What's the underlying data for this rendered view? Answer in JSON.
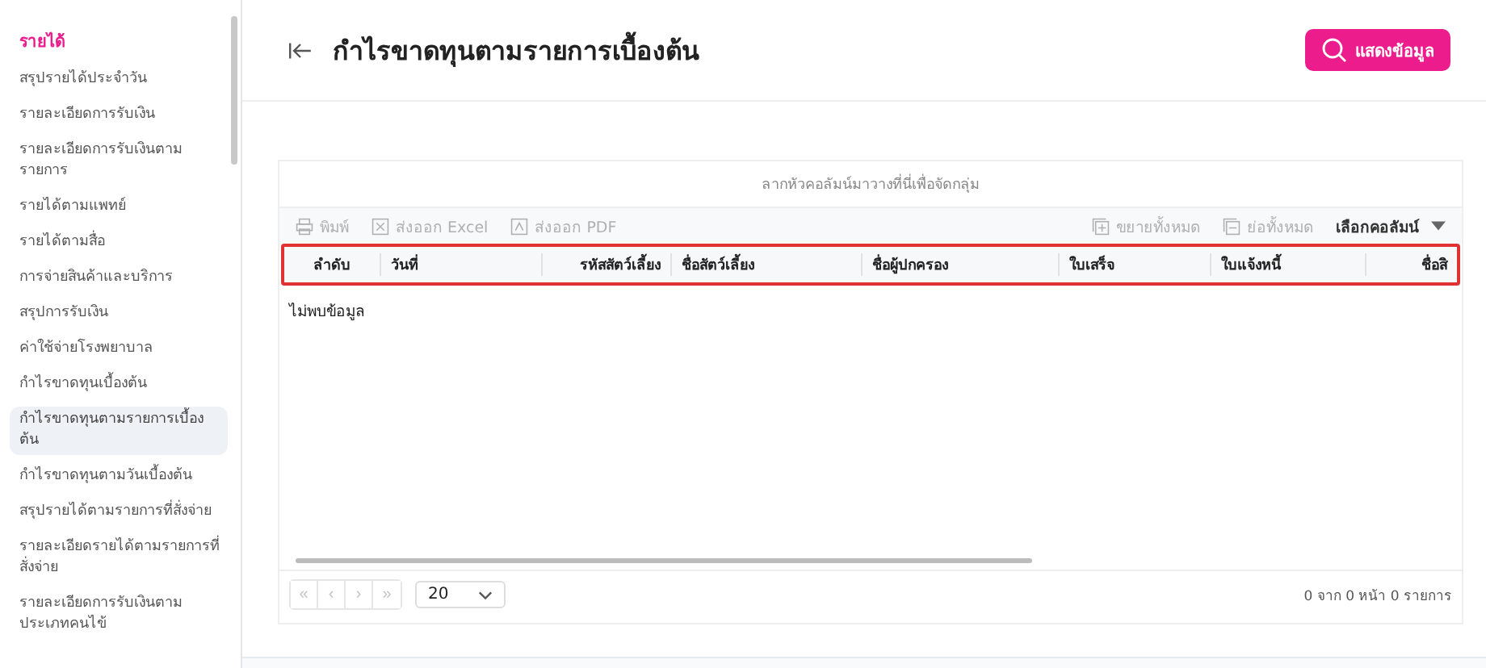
{
  "sidebar": {
    "section_title": "รายได้",
    "items": [
      {
        "label": "สรุปรายได้ประจำวัน",
        "selected": false
      },
      {
        "label": "รายละเอียดการรับเงิน",
        "selected": false
      },
      {
        "label": "รายละเอียดการรับเงินตามรายการ",
        "selected": false
      },
      {
        "label": "รายได้ตามแพทย์",
        "selected": false
      },
      {
        "label": "รายได้ตามสื่อ",
        "selected": false
      },
      {
        "label": "การจ่ายสินค้าและบริการ",
        "selected": false
      },
      {
        "label": "สรุปการรับเงิน",
        "selected": false
      },
      {
        "label": "ค่าใช้จ่ายโรงพยาบาล",
        "selected": false
      },
      {
        "label": "กำไรขาดทุนเบื้องต้น",
        "selected": false
      },
      {
        "label": "กำไรขาดทุนตามรายการเบื้องต้น",
        "selected": true
      },
      {
        "label": "กำไรขาดทุนตามวันเบื้องต้น",
        "selected": false
      },
      {
        "label": "สรุปรายได้ตามรายการที่สั่งจ่าย",
        "selected": false
      },
      {
        "label": "รายละเอียดรายได้ตามรายการที่สั่งจ่าย",
        "selected": false
      },
      {
        "label": "รายละเอียดการรับเงินตามประเภทคนไข้",
        "selected": false
      }
    ]
  },
  "page": {
    "title": "กำไรขาดทุนตามรายการเบื้องต้น",
    "show_button": "แสดงข้อมูล"
  },
  "grid": {
    "group_panel": "ลากหัวคอลัมน์มาวางที่นี่เพื่อจัดกลุ่ม",
    "toolbar": [
      {
        "kind": "print",
        "label": "พิมพ์",
        "disabled": true
      },
      {
        "kind": "excel",
        "label": "ส่งออก Excel",
        "disabled": true
      },
      {
        "kind": "pdf",
        "label": "ส่งออก PDF",
        "disabled": true
      }
    ],
    "toolbar_right": [
      {
        "kind": "expand",
        "label": "ขยายทั้งหมด",
        "disabled": true
      },
      {
        "kind": "collapse",
        "label": "ย่อทั้งหมด",
        "disabled": true
      }
    ],
    "column_chooser": "เลือกคอลัมน์",
    "header_highlighted": true,
    "columns": [
      {
        "label": "ลำดับ"
      },
      {
        "label": "วันที่"
      },
      {
        "label": "รหัสสัตว์เลี้ยง"
      },
      {
        "label": "ชื่อสัตว์เลี้ยง"
      },
      {
        "label": "ชื่อผู้ปกครอง"
      },
      {
        "label": "ใบเสร็จ"
      },
      {
        "label": "ใบแจ้งหนี้"
      },
      {
        "label": "ชื่อสิ"
      }
    ],
    "empty_text": "ไม่พบข้อมูล",
    "pager": {
      "page_size": "20",
      "info": "0 จาก 0 หน้า 0 รายการ",
      "buttons": [
        {
          "label": "«",
          "disabled": true
        },
        {
          "label": "‹",
          "disabled": true
        },
        {
          "label": "›",
          "disabled": true
        },
        {
          "label": "»",
          "disabled": true
        }
      ]
    }
  }
}
